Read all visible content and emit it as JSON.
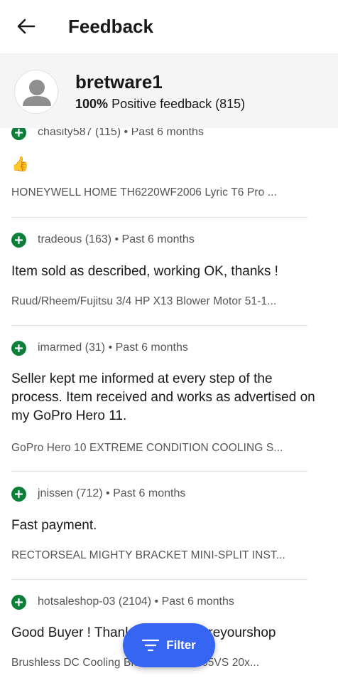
{
  "header": {
    "title": "Feedback"
  },
  "seller": {
    "username": "bretware1",
    "positive_percent": "100%",
    "positive_label": "Positive feedback (815)"
  },
  "feedback": [
    {
      "meta": "chasity587 (115) • Past 6 months",
      "comment": "👍",
      "product": "HONEYWELL HOME TH6220WF2006 Lyric T6 Pro ..."
    },
    {
      "meta": "tradeous (163) • Past 6 months",
      "comment": "Item sold as described, working OK, thanks !",
      "product": "Ruud/Rheem/Fujitsu 3/4 HP X13 Blower Motor 51-1..."
    },
    {
      "meta": "imarmed (31) • Past 6 months",
      "comment": "Seller kept me informed at every step of the process. Item received and works as advertised on my GoPro Hero 11.",
      "product": "GoPro Hero 10 EXTREME CONDITION COOLING S..."
    },
    {
      "meta": "jnissen (712) • Past 6 months",
      "comment": "Fast payment.",
      "product": "RECTORSEAL MIGHTY BRACKET MINI-SPLIT INST..."
    },
    {
      "meta": "hotsaleshop-03 (2104) • Past 6 months",
      "comment": "Good Buyer ! Thank you! From Areyourshop",
      "product": "Brushless DC Cooling Blower Fan 20065VS 20x..."
    }
  ],
  "filter": {
    "label": "Filter"
  },
  "colors": {
    "positive_green": "#0d7f3a",
    "accent_blue": "#3665f3"
  }
}
